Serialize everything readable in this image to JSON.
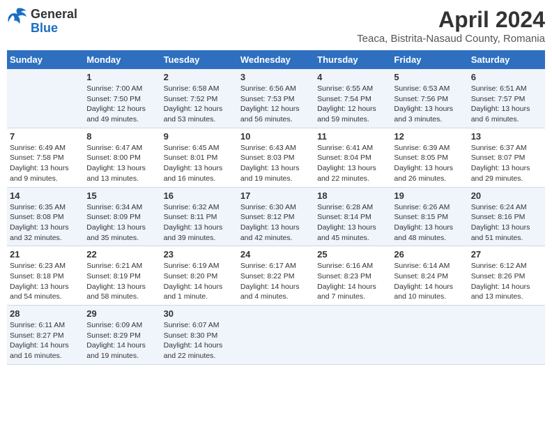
{
  "header": {
    "logo": {
      "line1": "General",
      "line2": "Blue"
    },
    "month_title": "April 2024",
    "location": "Teaca, Bistrita-Nasaud County, Romania"
  },
  "days_of_week": [
    "Sunday",
    "Monday",
    "Tuesday",
    "Wednesday",
    "Thursday",
    "Friday",
    "Saturday"
  ],
  "weeks": [
    [
      {
        "day": "",
        "info": ""
      },
      {
        "day": "1",
        "info": "Sunrise: 7:00 AM\nSunset: 7:50 PM\nDaylight: 12 hours\nand 49 minutes."
      },
      {
        "day": "2",
        "info": "Sunrise: 6:58 AM\nSunset: 7:52 PM\nDaylight: 12 hours\nand 53 minutes."
      },
      {
        "day": "3",
        "info": "Sunrise: 6:56 AM\nSunset: 7:53 PM\nDaylight: 12 hours\nand 56 minutes."
      },
      {
        "day": "4",
        "info": "Sunrise: 6:55 AM\nSunset: 7:54 PM\nDaylight: 12 hours\nand 59 minutes."
      },
      {
        "day": "5",
        "info": "Sunrise: 6:53 AM\nSunset: 7:56 PM\nDaylight: 13 hours\nand 3 minutes."
      },
      {
        "day": "6",
        "info": "Sunrise: 6:51 AM\nSunset: 7:57 PM\nDaylight: 13 hours\nand 6 minutes."
      }
    ],
    [
      {
        "day": "7",
        "info": "Sunrise: 6:49 AM\nSunset: 7:58 PM\nDaylight: 13 hours\nand 9 minutes."
      },
      {
        "day": "8",
        "info": "Sunrise: 6:47 AM\nSunset: 8:00 PM\nDaylight: 13 hours\nand 13 minutes."
      },
      {
        "day": "9",
        "info": "Sunrise: 6:45 AM\nSunset: 8:01 PM\nDaylight: 13 hours\nand 16 minutes."
      },
      {
        "day": "10",
        "info": "Sunrise: 6:43 AM\nSunset: 8:03 PM\nDaylight: 13 hours\nand 19 minutes."
      },
      {
        "day": "11",
        "info": "Sunrise: 6:41 AM\nSunset: 8:04 PM\nDaylight: 13 hours\nand 22 minutes."
      },
      {
        "day": "12",
        "info": "Sunrise: 6:39 AM\nSunset: 8:05 PM\nDaylight: 13 hours\nand 26 minutes."
      },
      {
        "day": "13",
        "info": "Sunrise: 6:37 AM\nSunset: 8:07 PM\nDaylight: 13 hours\nand 29 minutes."
      }
    ],
    [
      {
        "day": "14",
        "info": "Sunrise: 6:35 AM\nSunset: 8:08 PM\nDaylight: 13 hours\nand 32 minutes."
      },
      {
        "day": "15",
        "info": "Sunrise: 6:34 AM\nSunset: 8:09 PM\nDaylight: 13 hours\nand 35 minutes."
      },
      {
        "day": "16",
        "info": "Sunrise: 6:32 AM\nSunset: 8:11 PM\nDaylight: 13 hours\nand 39 minutes."
      },
      {
        "day": "17",
        "info": "Sunrise: 6:30 AM\nSunset: 8:12 PM\nDaylight: 13 hours\nand 42 minutes."
      },
      {
        "day": "18",
        "info": "Sunrise: 6:28 AM\nSunset: 8:14 PM\nDaylight: 13 hours\nand 45 minutes."
      },
      {
        "day": "19",
        "info": "Sunrise: 6:26 AM\nSunset: 8:15 PM\nDaylight: 13 hours\nand 48 minutes."
      },
      {
        "day": "20",
        "info": "Sunrise: 6:24 AM\nSunset: 8:16 PM\nDaylight: 13 hours\nand 51 minutes."
      }
    ],
    [
      {
        "day": "21",
        "info": "Sunrise: 6:23 AM\nSunset: 8:18 PM\nDaylight: 13 hours\nand 54 minutes."
      },
      {
        "day": "22",
        "info": "Sunrise: 6:21 AM\nSunset: 8:19 PM\nDaylight: 13 hours\nand 58 minutes."
      },
      {
        "day": "23",
        "info": "Sunrise: 6:19 AM\nSunset: 8:20 PM\nDaylight: 14 hours\nand 1 minute."
      },
      {
        "day": "24",
        "info": "Sunrise: 6:17 AM\nSunset: 8:22 PM\nDaylight: 14 hours\nand 4 minutes."
      },
      {
        "day": "25",
        "info": "Sunrise: 6:16 AM\nSunset: 8:23 PM\nDaylight: 14 hours\nand 7 minutes."
      },
      {
        "day": "26",
        "info": "Sunrise: 6:14 AM\nSunset: 8:24 PM\nDaylight: 14 hours\nand 10 minutes."
      },
      {
        "day": "27",
        "info": "Sunrise: 6:12 AM\nSunset: 8:26 PM\nDaylight: 14 hours\nand 13 minutes."
      }
    ],
    [
      {
        "day": "28",
        "info": "Sunrise: 6:11 AM\nSunset: 8:27 PM\nDaylight: 14 hours\nand 16 minutes."
      },
      {
        "day": "29",
        "info": "Sunrise: 6:09 AM\nSunset: 8:29 PM\nDaylight: 14 hours\nand 19 minutes."
      },
      {
        "day": "30",
        "info": "Sunrise: 6:07 AM\nSunset: 8:30 PM\nDaylight: 14 hours\nand 22 minutes."
      },
      {
        "day": "",
        "info": ""
      },
      {
        "day": "",
        "info": ""
      },
      {
        "day": "",
        "info": ""
      },
      {
        "day": "",
        "info": ""
      }
    ]
  ]
}
